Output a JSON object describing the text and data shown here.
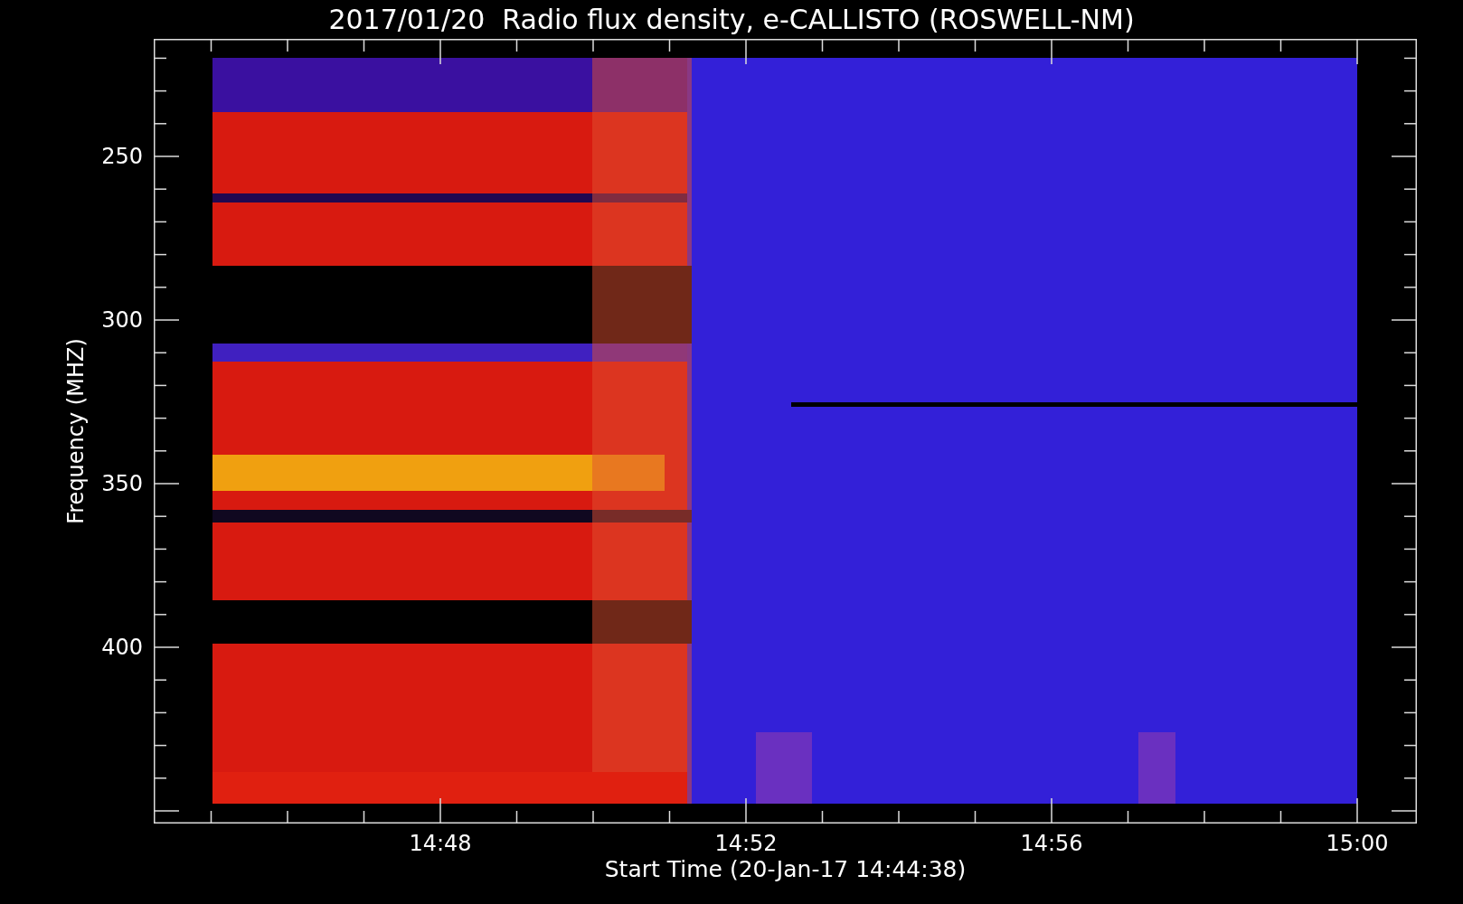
{
  "title": "2017/01/20  Radio flux density, e-CALLISTO (ROSWELL-NM)",
  "y_axis": {
    "label": "Frequency (MHZ)",
    "ticks": [
      "250",
      "300",
      "350",
      "400"
    ]
  },
  "x_axis": {
    "label": "Start Time (20-Jan-17 14:44:38)",
    "ticks": [
      "14:48",
      "14:52",
      "14:56",
      "15:00"
    ]
  }
}
